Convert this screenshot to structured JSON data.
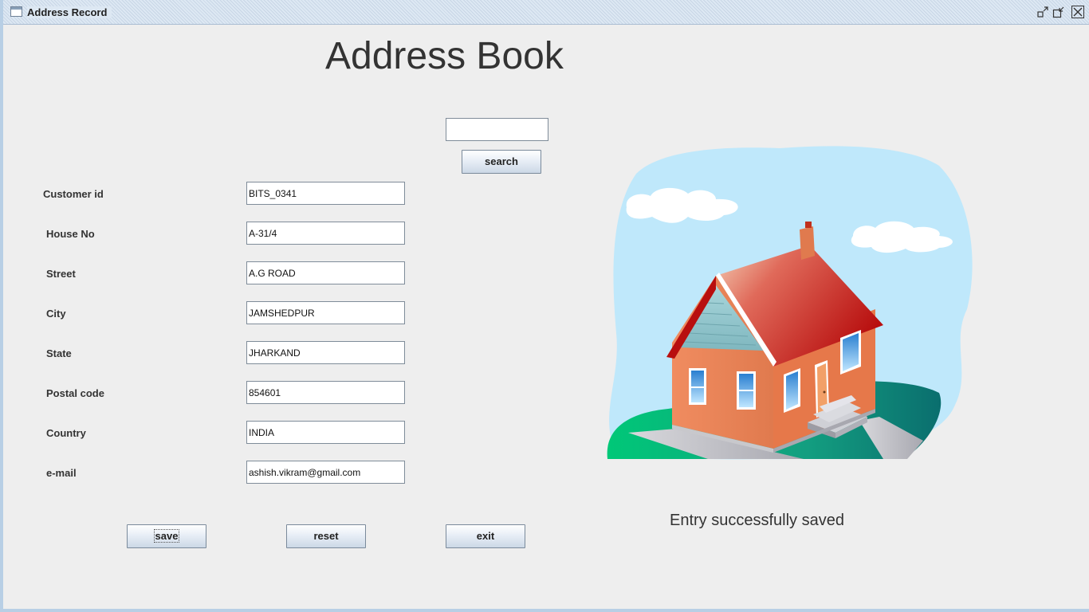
{
  "window": {
    "title": "Address Record",
    "controls": [
      "minimize-icon",
      "maximize-icon",
      "close-icon"
    ]
  },
  "heading": "Address Book",
  "search": {
    "value": "",
    "button_label": "search"
  },
  "fields": [
    {
      "label": "Customer id",
      "value": "BITS_0341"
    },
    {
      "label": "House No",
      "value": "A-31/4"
    },
    {
      "label": "Street",
      "value": "A.G ROAD"
    },
    {
      "label": "City",
      "value": "JAMSHEDPUR"
    },
    {
      "label": "State",
      "value": "JHARKAND"
    },
    {
      "label": "Postal code",
      "value": "854601"
    },
    {
      "label": "Country",
      "value": "INDIA"
    },
    {
      "label": "e-mail",
      "value": "ashish.vikram@gmail.com"
    }
  ],
  "buttons": {
    "save": "save",
    "reset": "reset",
    "exit": "exit"
  },
  "status": "Entry successfully saved",
  "illustration": "house-illustration"
}
